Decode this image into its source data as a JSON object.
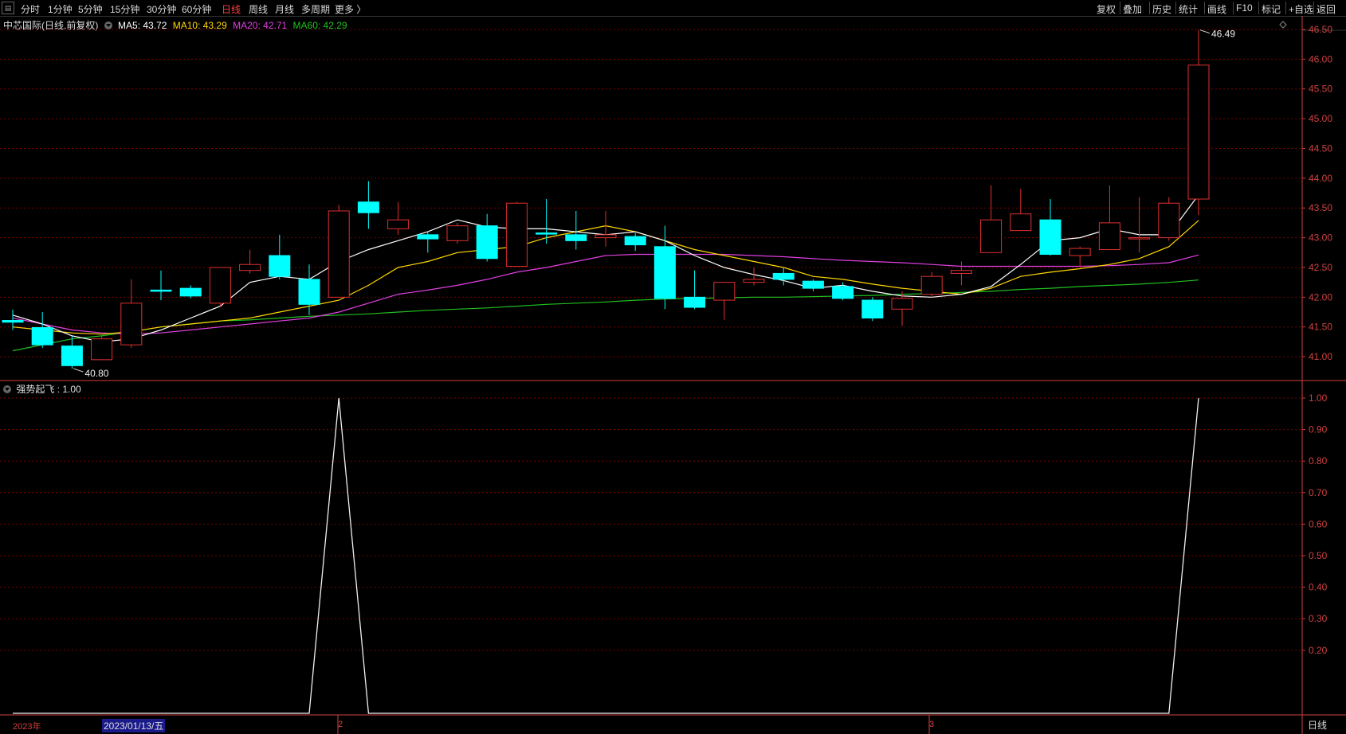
{
  "toolbar": {
    "left_items": [
      "分时",
      "1分钟",
      "5分钟",
      "15分钟",
      "30分钟",
      "60分钟",
      "日线",
      "周线",
      "月线",
      "多周期",
      "更多 〉"
    ],
    "active_item": "日线",
    "right_items": [
      "复权",
      "叠加",
      "历史",
      "统计",
      "画线",
      "F10",
      "标记",
      "+自选",
      "返回"
    ]
  },
  "legend": {
    "title": "中芯国际(日线,前复权)",
    "ma5": "MA5: 43.72",
    "ma10": "MA10: 43.29",
    "ma20": "MA20: 42.71",
    "ma60": "MA60: 42.29"
  },
  "colors": {
    "ma5": "#ffffff",
    "ma10": "#ffd700",
    "ma20": "#e040e0",
    "ma60": "#20c020",
    "up": "#e03030",
    "down": "#00ffff",
    "grid": "#7a0000",
    "axis": "#d04040"
  },
  "price_axis": {
    "ticks": [
      "46.50",
      "46.00",
      "45.50",
      "45.00",
      "44.50",
      "44.00",
      "43.50",
      "43.00",
      "42.50",
      "42.00",
      "41.50",
      "41.00"
    ],
    "range": [
      40.6,
      46.7
    ]
  },
  "annotations": {
    "high": "46.49",
    "low": "40.80"
  },
  "indicator": {
    "label": "强势起飞 : 1.00",
    "ticks": [
      "1.00",
      "0.90",
      "0.80",
      "0.70",
      "0.60",
      "0.50",
      "0.40",
      "0.30",
      "0.20"
    ],
    "range": [
      0,
      1
    ]
  },
  "dates": {
    "year": "2023年",
    "m2": "2",
    "m3": "3",
    "selected": "2023/01/13/五"
  },
  "bottom_tab": "日线",
  "chart_data": {
    "type": "candlestick",
    "candles": [
      {
        "o": 41.61,
        "c": 41.58,
        "h": 41.79,
        "l": 41.45
      },
      {
        "o": 41.49,
        "c": 41.2,
        "h": 41.75,
        "l": 41.15
      },
      {
        "o": 41.18,
        "c": 40.85,
        "h": 41.35,
        "l": 40.8
      },
      {
        "o": 40.95,
        "c": 41.3,
        "h": 41.4,
        "l": 40.95
      },
      {
        "o": 41.2,
        "c": 41.9,
        "h": 42.3,
        "l": 41.15
      },
      {
        "o": 42.12,
        "c": 42.1,
        "h": 42.45,
        "l": 41.95
      },
      {
        "o": 42.15,
        "c": 42.02,
        "h": 42.2,
        "l": 41.98
      },
      {
        "o": 41.9,
        "c": 42.5,
        "h": 42.5,
        "l": 41.85
      },
      {
        "o": 42.45,
        "c": 42.55,
        "h": 42.8,
        "l": 42.4
      },
      {
        "o": 42.7,
        "c": 42.35,
        "h": 43.05,
        "l": 42.3
      },
      {
        "o": 42.3,
        "c": 41.88,
        "h": 42.55,
        "l": 41.7
      },
      {
        "o": 42.0,
        "c": 43.45,
        "h": 43.55,
        "l": 42.0
      },
      {
        "o": 43.6,
        "c": 43.42,
        "h": 43.95,
        "l": 43.15
      },
      {
        "o": 43.15,
        "c": 43.3,
        "h": 43.6,
        "l": 43.05
      },
      {
        "o": 43.05,
        "c": 42.98,
        "h": 43.1,
        "l": 42.75
      },
      {
        "o": 42.95,
        "c": 43.2,
        "h": 43.25,
        "l": 42.9
      },
      {
        "o": 43.2,
        "c": 42.65,
        "h": 43.4,
        "l": 42.6
      },
      {
        "o": 42.52,
        "c": 43.58,
        "h": 43.6,
        "l": 42.52
      },
      {
        "o": 43.08,
        "c": 43.06,
        "h": 43.65,
        "l": 42.9
      },
      {
        "o": 43.05,
        "c": 42.95,
        "h": 43.45,
        "l": 42.8
      },
      {
        "o": 43.0,
        "c": 43.05,
        "h": 43.45,
        "l": 42.85
      },
      {
        "o": 43.02,
        "c": 42.88,
        "h": 43.08,
        "l": 42.78
      },
      {
        "o": 42.85,
        "c": 41.98,
        "h": 43.2,
        "l": 41.8
      },
      {
        "o": 42.0,
        "c": 41.83,
        "h": 42.45,
        "l": 41.8
      },
      {
        "o": 41.95,
        "c": 42.25,
        "h": 42.25,
        "l": 41.62
      },
      {
        "o": 42.25,
        "c": 42.3,
        "h": 42.5,
        "l": 42.2
      },
      {
        "o": 42.4,
        "c": 42.3,
        "h": 42.5,
        "l": 42.2
      },
      {
        "o": 42.27,
        "c": 42.15,
        "h": 42.3,
        "l": 42.1
      },
      {
        "o": 42.18,
        "c": 41.98,
        "h": 42.25,
        "l": 41.95
      },
      {
        "o": 41.95,
        "c": 41.65,
        "h": 42.0,
        "l": 41.6
      },
      {
        "o": 41.8,
        "c": 41.98,
        "h": 42.1,
        "l": 41.52
      },
      {
        "o": 42.05,
        "c": 42.35,
        "h": 42.42,
        "l": 42.0
      },
      {
        "o": 42.4,
        "c": 42.45,
        "h": 42.6,
        "l": 42.2
      },
      {
        "o": 42.75,
        "c": 43.3,
        "h": 43.88,
        "l": 42.75
      },
      {
        "o": 43.12,
        "c": 43.4,
        "h": 43.82,
        "l": 43.12
      },
      {
        "o": 43.3,
        "c": 42.72,
        "h": 43.65,
        "l": 42.7
      },
      {
        "o": 42.7,
        "c": 42.82,
        "h": 42.85,
        "l": 42.5
      },
      {
        "o": 42.8,
        "c": 43.25,
        "h": 43.88,
        "l": 42.8
      },
      {
        "o": 43.0,
        "c": 43.0,
        "h": 43.68,
        "l": 42.75
      },
      {
        "o": 43.0,
        "c": 43.58,
        "h": 43.68,
        "l": 42.95
      },
      {
        "o": 43.65,
        "c": 45.9,
        "h": 46.49,
        "l": 43.38
      }
    ],
    "ma5": [
      41.7,
      41.55,
      41.35,
      41.25,
      41.3,
      41.45,
      41.65,
      41.85,
      42.25,
      42.35,
      42.3,
      42.6,
      42.8,
      42.95,
      43.1,
      43.3,
      43.18,
      43.15,
      43.15,
      43.1,
      43.05,
      43.1,
      42.95,
      42.7,
      42.5,
      42.38,
      42.28,
      42.15,
      42.2,
      42.1,
      42.02,
      42.0,
      42.05,
      42.18,
      42.55,
      42.95,
      43.0,
      43.15,
      43.05,
      43.05,
      43.72
    ],
    "ma10": [
      41.5,
      41.45,
      41.4,
      41.38,
      41.42,
      41.5,
      41.55,
      41.6,
      41.65,
      41.75,
      41.85,
      41.95,
      42.2,
      42.5,
      42.6,
      42.75,
      42.8,
      42.85,
      43.0,
      43.1,
      43.2,
      43.1,
      42.95,
      42.8,
      42.7,
      42.6,
      42.5,
      42.35,
      42.3,
      42.22,
      42.15,
      42.1,
      42.05,
      42.15,
      42.35,
      42.42,
      42.48,
      42.55,
      42.65,
      42.85,
      43.29
    ],
    "ma20": [
      41.65,
      41.55,
      41.45,
      41.4,
      41.38,
      41.4,
      41.45,
      41.5,
      41.55,
      41.6,
      41.65,
      41.75,
      41.9,
      42.05,
      42.12,
      42.2,
      42.3,
      42.42,
      42.5,
      42.6,
      42.7,
      42.72,
      42.72,
      42.72,
      42.72,
      42.7,
      42.68,
      42.65,
      42.62,
      42.6,
      42.58,
      42.55,
      42.52,
      42.52,
      42.52,
      42.52,
      42.52,
      42.53,
      42.55,
      42.58,
      42.71
    ],
    "ma60": [
      41.1,
      41.2,
      41.3,
      41.35,
      41.42,
      41.5,
      41.55,
      41.6,
      41.62,
      41.65,
      41.68,
      41.7,
      41.72,
      41.75,
      41.78,
      41.8,
      41.82,
      41.85,
      41.88,
      41.9,
      41.92,
      41.95,
      41.97,
      41.98,
      41.99,
      42.0,
      42.0,
      42.01,
      42.02,
      42.03,
      42.05,
      42.06,
      42.08,
      42.1,
      42.13,
      42.15,
      42.18,
      42.2,
      42.22,
      42.25,
      42.29
    ],
    "indicator_values": [
      0,
      0,
      0,
      0,
      0,
      0,
      0,
      0,
      0,
      0,
      0,
      1,
      0,
      0,
      0,
      0,
      0,
      0,
      0,
      0,
      0,
      0,
      0,
      0,
      0,
      0,
      0,
      0,
      0,
      0,
      0,
      0,
      0,
      0,
      0,
      0,
      0,
      0,
      0,
      0,
      1
    ]
  }
}
